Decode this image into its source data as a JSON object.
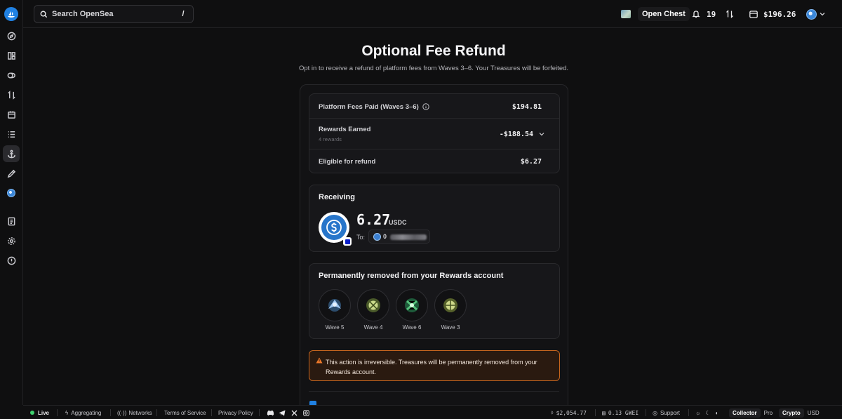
{
  "topbar": {
    "search_placeholder": "Search OpenSea",
    "search_shortcut": "/",
    "open_chest_label": "Open Chest",
    "notifications_count": "19",
    "wallet_balance": "$196.26"
  },
  "sidebar": {
    "items": [
      {
        "name": "discover",
        "icon": "compass-icon"
      },
      {
        "name": "collections",
        "icon": "grid-icon"
      },
      {
        "name": "tokens",
        "icon": "token-icon"
      },
      {
        "name": "swap",
        "icon": "swap-icon"
      },
      {
        "name": "drops",
        "icon": "calendar-icon"
      },
      {
        "name": "activity",
        "icon": "list-icon"
      },
      {
        "name": "rewards",
        "icon": "anchor-icon"
      },
      {
        "name": "studio",
        "icon": "pen-icon"
      },
      {
        "name": "profile",
        "icon": "avatar-icon"
      },
      {
        "name": "docs",
        "icon": "book-icon"
      },
      {
        "name": "settings",
        "icon": "gear-icon"
      },
      {
        "name": "support",
        "icon": "help-icon"
      }
    ]
  },
  "main": {
    "title": "Optional Fee Refund",
    "subtitle": "Opt in to receive a refund of platform fees from Waves 3–6. Your Treasures will be forfeited."
  },
  "summary": {
    "fees_label": "Platform Fees Paid (Waves 3–6)",
    "fees_value": "$194.81",
    "rewards_label": "Rewards Earned",
    "rewards_sub": "4 rewards",
    "rewards_value": "-$188.54",
    "eligible_label": "Eligible for refund",
    "eligible_value": "$6.27"
  },
  "receiving": {
    "title": "Receiving",
    "amount": "6.27",
    "currency": "USDC",
    "to_label": "To:",
    "address_initial": "0"
  },
  "removed": {
    "title": "Permanently removed from your Rewards account",
    "treasures": [
      {
        "label": "Wave 5",
        "color": "#9fc7f2"
      },
      {
        "label": "Wave 4",
        "color": "#c9d98a"
      },
      {
        "label": "Wave 6",
        "color": "#55c07a"
      },
      {
        "label": "Wave 3",
        "color": "#cfd98a"
      }
    ]
  },
  "warning": {
    "text": "This action is irreversible. Treasures will be permanently removed from your Rewards account."
  },
  "footer": {
    "live": "Live",
    "aggregating": "Aggregating",
    "networks": "Networks",
    "terms": "Terms of Service",
    "privacy": "Privacy Policy",
    "eth_price": "$2,054.77",
    "gas": "0.13 GWEI",
    "support": "Support",
    "mode_collector": "Collector",
    "mode_pro": "Pro",
    "currency_crypto": "Crypto",
    "currency_usd": "USD"
  },
  "colors": {
    "accent": "#2081e2",
    "live": "#3fd26f",
    "warning_border": "#c8661e",
    "usdc": "#2775ca"
  }
}
